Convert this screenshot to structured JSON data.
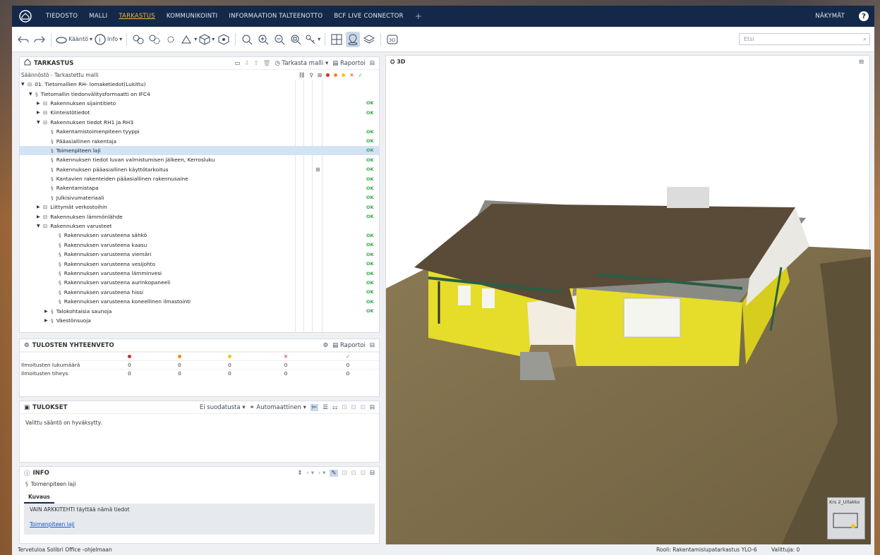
{
  "menu": {
    "items": [
      "TIEDOSTO",
      "MALLI",
      "TARKASTUS",
      "KOMMUNIKOINTI",
      "INFORMAATION TALTEENOTTO",
      "BCF LIVE CONNECTOR"
    ],
    "active": "TARKASTUS",
    "plus": "+",
    "views": "NÄKYMÄT",
    "help": "?"
  },
  "toolbar": {
    "kaanto": "Kääntö",
    "info": "Info",
    "search_placeholder": "Etsi"
  },
  "tarkastus": {
    "title": "TARKASTUS",
    "check_model": "Tarkasta malli",
    "report": "Raportoi",
    "tree_header": "Säännöstö - Tarkastettu malli",
    "rows": [
      {
        "label": "01. Tietomallien RH- lomaketiedot(Lukittu)",
        "indent": 0,
        "caret": "▼",
        "kind": "set",
        "ok": ""
      },
      {
        "label": "Tietomallin tiedonvälitysformaatti on IFC4",
        "indent": 1,
        "caret": "▼",
        "kind": "rule",
        "ok": ""
      },
      {
        "label": "Rakennuksen sijaintitieto",
        "indent": 2,
        "caret": "▶",
        "kind": "set",
        "ok": "OK"
      },
      {
        "label": "Kiinteistötiedot",
        "indent": 2,
        "caret": "▶",
        "kind": "set",
        "ok": "OK"
      },
      {
        "label": "Rakennuksen tiedot RH1 ja RH3",
        "indent": 2,
        "caret": "▼",
        "kind": "set",
        "ok": ""
      },
      {
        "label": "Rakentamistoimenpiteen tyyppi",
        "indent": 3,
        "caret": "",
        "kind": "rule",
        "ok": "OK"
      },
      {
        "label": "Pääasiallinen rakentaja",
        "indent": 3,
        "caret": "",
        "kind": "rule",
        "ok": "OK"
      },
      {
        "label": "Toimenpiteen laji",
        "indent": 3,
        "caret": "",
        "kind": "rule",
        "ok": "OK",
        "sel": true
      },
      {
        "label": "Rakennuksen tiedot luvan valmistumisen jälkeen, Kerrosluku",
        "indent": 3,
        "caret": "",
        "kind": "rule",
        "ok": "OK"
      },
      {
        "label": "Rakennuksen pääasiallinen käyttötarkoitus",
        "indent": 3,
        "caret": "",
        "kind": "rule",
        "ok": "OK",
        "grid": true
      },
      {
        "label": "Kantavien rakenteiden pääasiallinen rakennusaine",
        "indent": 3,
        "caret": "",
        "kind": "rule",
        "ok": "OK"
      },
      {
        "label": "Rakentamistapa",
        "indent": 3,
        "caret": "",
        "kind": "rule",
        "ok": "OK"
      },
      {
        "label": "Julkisivumateriaali",
        "indent": 3,
        "caret": "",
        "kind": "rule",
        "ok": "OK"
      },
      {
        "label": "Liittymät verkostoihin",
        "indent": 2,
        "caret": "▶",
        "kind": "set",
        "ok": "OK"
      },
      {
        "label": "Rakennuksen lämmönlähde",
        "indent": 2,
        "caret": "▶",
        "kind": "set",
        "ok": "OK"
      },
      {
        "label": "Rakennuksen varusteet",
        "indent": 2,
        "caret": "▼",
        "kind": "set",
        "ok": ""
      },
      {
        "label": "Rakennuksen varusteena sähkö",
        "indent": 4,
        "caret": "",
        "kind": "rule",
        "ok": "OK"
      },
      {
        "label": "Rakennuksen varusteena kaasu",
        "indent": 4,
        "caret": "",
        "kind": "rule",
        "ok": "OK"
      },
      {
        "label": "Rakennuksen varusteena viemäri",
        "indent": 4,
        "caret": "",
        "kind": "rule",
        "ok": "OK"
      },
      {
        "label": "Rakennuksen varusteena vesijohto",
        "indent": 4,
        "caret": "",
        "kind": "rule",
        "ok": "OK"
      },
      {
        "label": "Rakennuksen varusteena lämminvesi",
        "indent": 4,
        "caret": "",
        "kind": "rule",
        "ok": "OK"
      },
      {
        "label": "Rakennuksen varusteena aurinkopaneeli",
        "indent": 4,
        "caret": "",
        "kind": "rule",
        "ok": "OK"
      },
      {
        "label": "Rakennuksen varusteena hissi",
        "indent": 4,
        "caret": "",
        "kind": "rule",
        "ok": "OK"
      },
      {
        "label": "Rakennuksen varusteena koneellinen ilmastointi",
        "indent": 4,
        "caret": "",
        "kind": "rule",
        "ok": "OK"
      },
      {
        "label": "Talokohtaisia saunoja",
        "indent": 3,
        "caret": "▶",
        "kind": "rule",
        "ok": "OK"
      },
      {
        "label": "Väestönsuoja",
        "indent": 3,
        "caret": "▶",
        "kind": "rule",
        "ok": ""
      }
    ]
  },
  "summary": {
    "title": "TULOSTEN YHTEENVETO",
    "report": "Raportoi",
    "rows": [
      {
        "label": "Ilmoitusten lukumäärä",
        "values": [
          "0",
          "0",
          "0",
          "0",
          "0"
        ]
      },
      {
        "label": "Ilmoitusten tiheys",
        "values": [
          "0",
          "0",
          "0",
          "0",
          "0"
        ]
      }
    ]
  },
  "results": {
    "title": "TULOKSET",
    "filter": "Ei suodatusta",
    "auto": "Automaattinen",
    "message": "Valittu sääntö on hyväksytty."
  },
  "info": {
    "title": "INFO",
    "rule": "Toimenpiteen laji",
    "tab": "Kuvaus",
    "text": "VAIN ARKKITEHTI täyttää nämä tiedot",
    "link": "Toimenpiteen laji"
  },
  "view3d": {
    "title": "3D",
    "floor": "Krs 2_Ullakko"
  },
  "status": {
    "left": "Tervetuloa Solibri Office -ohjelmaan",
    "role": "Rooli: Rakentamislupatarkastus YLO-6",
    "selected": "Valittuja: 0"
  },
  "colors": {
    "menubar": "#14294a",
    "active": "#f3b545",
    "ok": "#35a84b",
    "red": "#d62b2b",
    "orange": "#f08a1e",
    "yellow": "#f5c518",
    "wall": "#e6dc2a",
    "roof": "#5a4a38"
  }
}
